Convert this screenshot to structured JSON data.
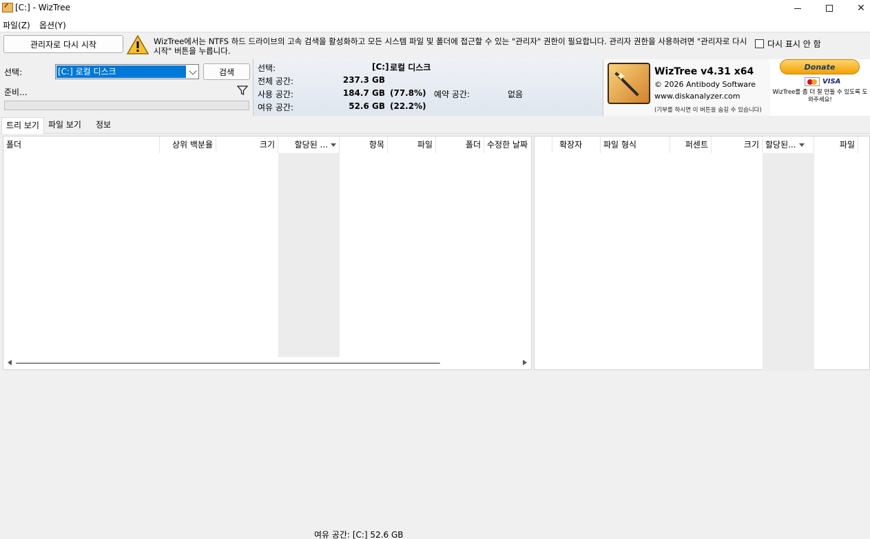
{
  "window": {
    "title": "[C:]  - WizTree",
    "min_glyph": "—",
    "close_glyph": "✕"
  },
  "menu": {
    "file": "파일(Z)",
    "options": "옵션(Y)"
  },
  "admin": {
    "restart_button": "관리자로 다시 시작",
    "warning_text": "WizTree에서는 NTFS 하드 드라이브의 고속 검색을 활성화하고 모든 시스템 파일 및 폴더에 접근할 수 있는 \"관리자\" 권한이 필요합니다. 관리자 권한을 사용하려면 \"관리자로 다시 시작\" 버튼을 누릅니다.",
    "dont_show_label": "다시 표시 안 함"
  },
  "select": {
    "label": "선택:",
    "drive_value": "[C:] 로컬 디스크",
    "search_button": "검색",
    "status": "준비..."
  },
  "drive_info": {
    "select_label": "선택:",
    "drive_letter": "[C:]",
    "drive_name": "로컬 디스크",
    "total_label": "전체 공간:",
    "total_value": "237.3 GB",
    "used_label": "사용 공간:",
    "used_value": "184.7 GB",
    "used_pct": "(77.8%)",
    "reserved_label": "예약 공간:",
    "reserved_value": "없음",
    "free_label": "여유 공간:",
    "free_value": "52.6 GB",
    "free_pct": "(22.2%)"
  },
  "brand": {
    "title": "WizTree v4.31 x64",
    "copyright": "© 2026 Antibody Software",
    "website": "www.diskanalyzer.com",
    "note": "(기부를 하시면 이 버튼을 숨길 수 있습니다)"
  },
  "donate": {
    "button": "Donate",
    "visa": "VISA",
    "note": "WizTree를 좀 더 잘 만들 수 있도록 도와주세요!"
  },
  "tabs": [
    "트리 보기",
    "파일 보기",
    "정보"
  ],
  "tree_columns": [
    "폴더",
    "상위 백분율",
    "크기",
    "할당된 ...",
    "항목",
    "파일",
    "폴더",
    "수정한 날짜"
  ],
  "ext_columns": [
    "확장자",
    "파일 형식",
    "퍼센트",
    "크기",
    "할당된...",
    "파일"
  ],
  "footer": "여유 공간: [C:] 52.6 GB"
}
